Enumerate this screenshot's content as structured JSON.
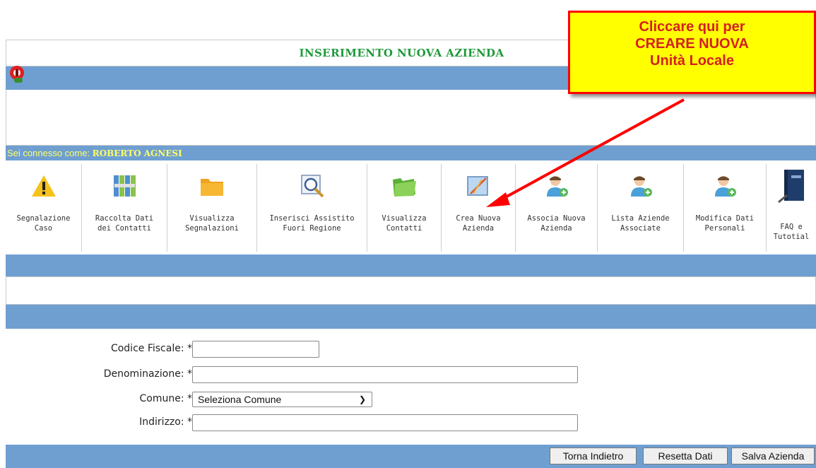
{
  "header": {
    "title": "INSERIMENTO NUOVA AZIENDA"
  },
  "user_bar": {
    "prefix": "Sei connesso come: ",
    "user_name": "ROBERTO AGNESI"
  },
  "toolbar": {
    "items": [
      {
        "label": "Segnalazione\nCaso",
        "icon": "warning-icon"
      },
      {
        "label": "Raccolta Dati\ndei Contatti",
        "icon": "binders-icon"
      },
      {
        "label": "Visualizza\nSegnalazioni",
        "icon": "folder-icon"
      },
      {
        "label": "Inserisci Assistito\nFuori Regione",
        "icon": "magnifier-icon"
      },
      {
        "label": "Visualizza\nContatti",
        "icon": "green-folder-icon"
      },
      {
        "label": "Crea Nuova\nAzienda",
        "icon": "drawing-icon"
      },
      {
        "label": "Associa Nuova\nAzienda",
        "icon": "user-add-icon"
      },
      {
        "label": "Lista Aziende\nAssociate",
        "icon": "user-add-icon"
      },
      {
        "label": "Modifica Dati\nPersonali",
        "icon": "user-add-icon"
      },
      {
        "label": "FAQ e\nTutotial",
        "icon": "book-icon"
      }
    ]
  },
  "form": {
    "codice_fiscale_label": "Codice Fiscale: *",
    "denominazione_label": "Denominazione: *",
    "comune_label": "Comune: *",
    "comune_selected": "Seleziona Comune",
    "indirizzo_label": "Indirizzo: *"
  },
  "buttons": {
    "back": "Torna Indietro",
    "reset": "Resetta Dati",
    "save": "Salva Azienda"
  },
  "callout": {
    "line1": "Cliccare qui per",
    "line2": "CREARE NUOVA",
    "line3": "Unità Locale"
  },
  "colors": {
    "band_blue": "#6f9fd1",
    "title_green": "#1f9a3a",
    "user_yellow": "#ffff66",
    "callout_yellow": "#ffff00",
    "callout_red": "#ff0000"
  }
}
